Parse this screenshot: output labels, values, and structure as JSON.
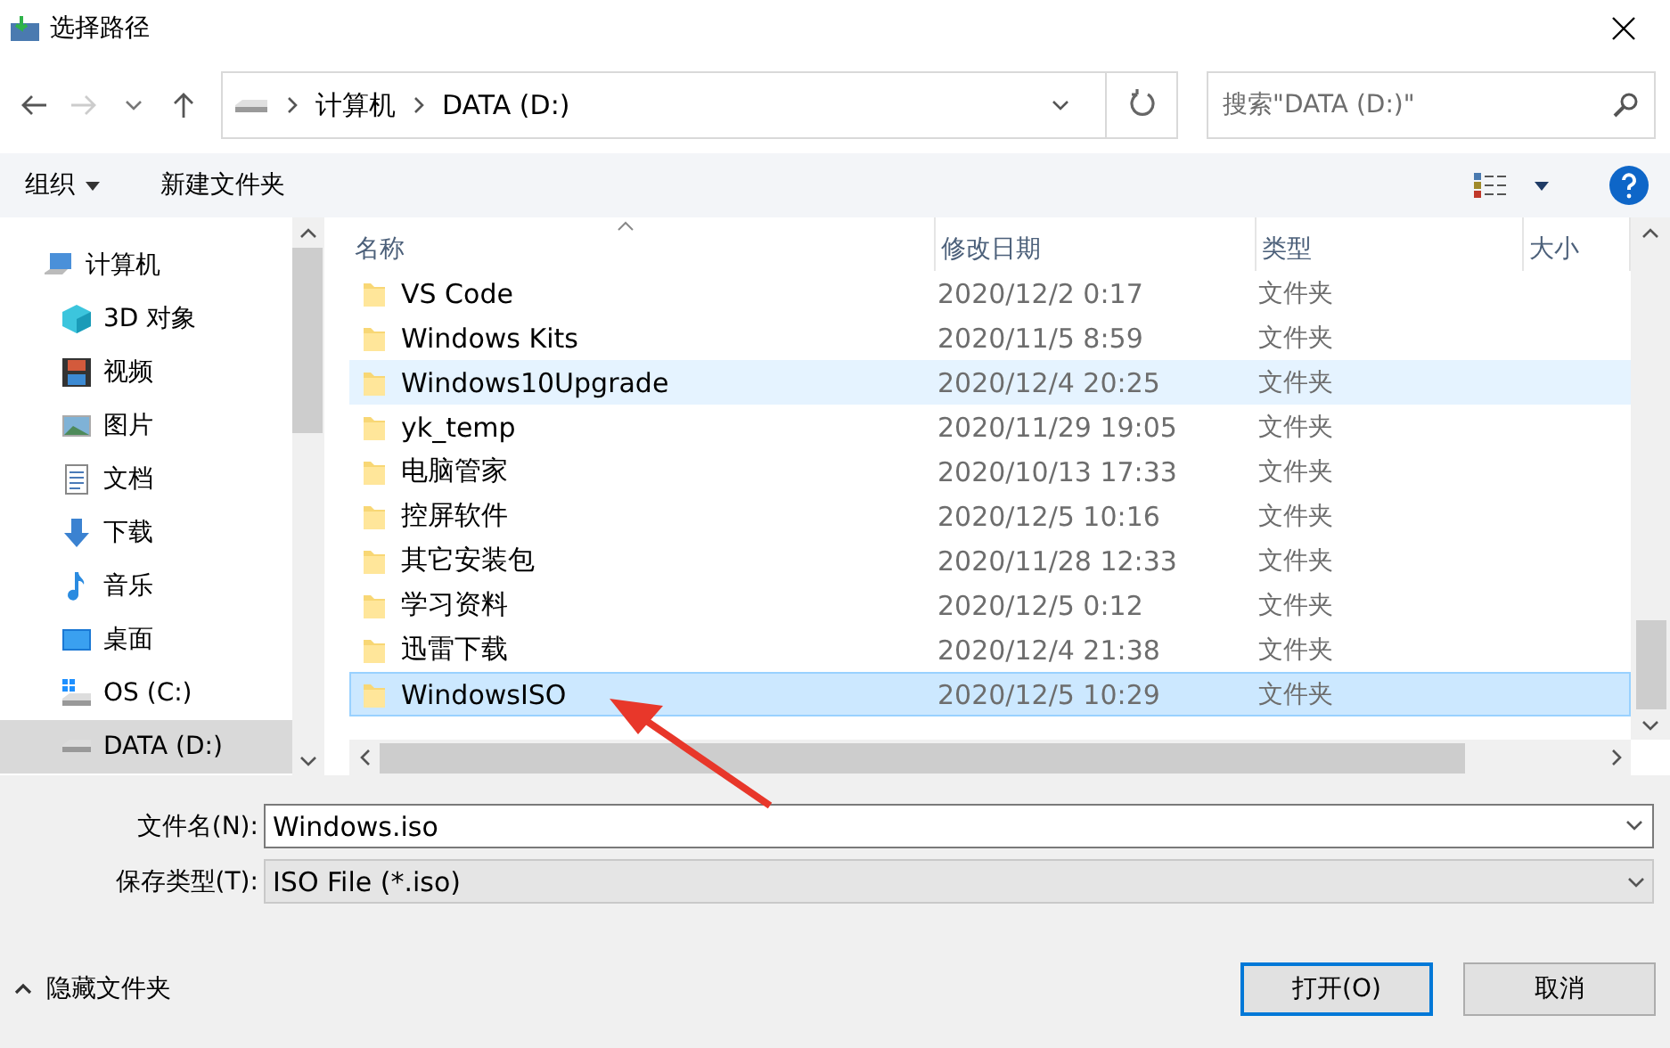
{
  "window": {
    "title": "选择路径"
  },
  "address": {
    "crumbs": [
      "计算机",
      "DATA (D:)"
    ],
    "search_placeholder": "搜索\"DATA (D:)\""
  },
  "toolbar": {
    "organize": "组织",
    "new_folder": "新建文件夹"
  },
  "sidebar": {
    "items": [
      {
        "label": "计算机",
        "kind": "computer",
        "selected": false,
        "indent": false
      },
      {
        "label": "3D 对象",
        "kind": "cube",
        "selected": false,
        "indent": true
      },
      {
        "label": "视频",
        "kind": "video",
        "selected": false,
        "indent": true
      },
      {
        "label": "图片",
        "kind": "picture",
        "selected": false,
        "indent": true
      },
      {
        "label": "文档",
        "kind": "document",
        "selected": false,
        "indent": true
      },
      {
        "label": "下载",
        "kind": "download",
        "selected": false,
        "indent": true
      },
      {
        "label": "音乐",
        "kind": "music",
        "selected": false,
        "indent": true
      },
      {
        "label": "桌面",
        "kind": "desktop",
        "selected": false,
        "indent": true
      },
      {
        "label": "OS (C:)",
        "kind": "osdrive",
        "selected": false,
        "indent": true
      },
      {
        "label": "DATA (D:)",
        "kind": "drive",
        "selected": true,
        "indent": true
      }
    ]
  },
  "table": {
    "columns": [
      "名称",
      "修改日期",
      "类型",
      "大小"
    ],
    "rows": [
      {
        "name": "VS Code",
        "date": "2020/12/2 0:17",
        "type": "文件夹",
        "selected": false,
        "hovered": false
      },
      {
        "name": "Windows Kits",
        "date": "2020/11/5 8:59",
        "type": "文件夹",
        "selected": false,
        "hovered": false
      },
      {
        "name": "Windows10Upgrade",
        "date": "2020/12/4 20:25",
        "type": "文件夹",
        "selected": false,
        "hovered": true
      },
      {
        "name": "yk_temp",
        "date": "2020/11/29 19:05",
        "type": "文件夹",
        "selected": false,
        "hovered": false
      },
      {
        "name": "电脑管家",
        "date": "2020/10/13 17:33",
        "type": "文件夹",
        "selected": false,
        "hovered": false
      },
      {
        "name": "控屏软件",
        "date": "2020/12/5 10:16",
        "type": "文件夹",
        "selected": false,
        "hovered": false
      },
      {
        "name": "其它安装包",
        "date": "2020/11/28 12:33",
        "type": "文件夹",
        "selected": false,
        "hovered": false
      },
      {
        "name": "学习资料",
        "date": "2020/12/5 0:12",
        "type": "文件夹",
        "selected": false,
        "hovered": false
      },
      {
        "name": "迅雷下载",
        "date": "2020/12/4 21:38",
        "type": "文件夹",
        "selected": false,
        "hovered": false
      },
      {
        "name": "WindowsISO",
        "date": "2020/12/5 10:29",
        "type": "文件夹",
        "selected": true,
        "hovered": false
      }
    ]
  },
  "form": {
    "filename_label": "文件名(N):",
    "filename_value": "Windows.iso",
    "filetype_label": "保存类型(T):",
    "filetype_value": "ISO File (*.iso)"
  },
  "footer": {
    "hide_folders": "隐藏文件夹",
    "buttons": [
      "打开(O)",
      "取消"
    ]
  }
}
